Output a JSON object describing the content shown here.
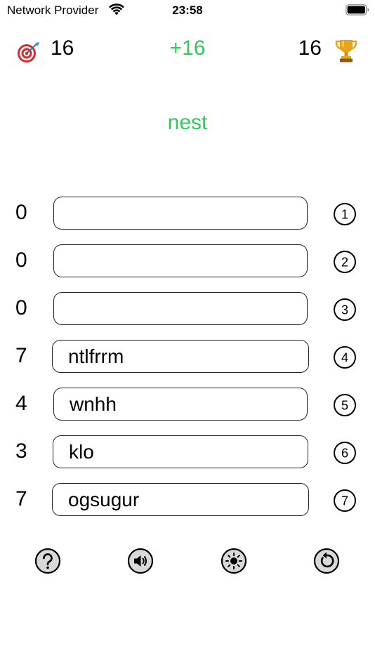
{
  "status_bar": {
    "carrier": "Network Provider",
    "time": "23:58",
    "wifi_icon": "wifi-icon",
    "battery_icon": "battery-icon"
  },
  "header": {
    "target_icon": "target-dart-icon",
    "score": "16",
    "delta": "+16",
    "best": "16",
    "trophy_icon": "trophy-icon"
  },
  "word": "nest",
  "colors": {
    "accent_green": "#34c759",
    "border": "#222222",
    "button_fill": "#d9d9d9"
  },
  "rows": [
    {
      "count": "0",
      "value": "",
      "number": "1"
    },
    {
      "count": "0",
      "value": "",
      "number": "2"
    },
    {
      "count": "0",
      "value": "",
      "number": "3"
    },
    {
      "count": "7",
      "value": "ntlfrrm",
      "number": "4"
    },
    {
      "count": "4",
      "value": "wnhh",
      "number": "5"
    },
    {
      "count": "3",
      "value": "klo",
      "number": "6"
    },
    {
      "count": "7",
      "value": "ogsugur",
      "number": "7"
    }
  ],
  "toolbar": {
    "help_icon": "question-icon",
    "sound_icon": "speaker-icon",
    "brightness_icon": "sun-icon",
    "restart_icon": "restart-icon"
  }
}
